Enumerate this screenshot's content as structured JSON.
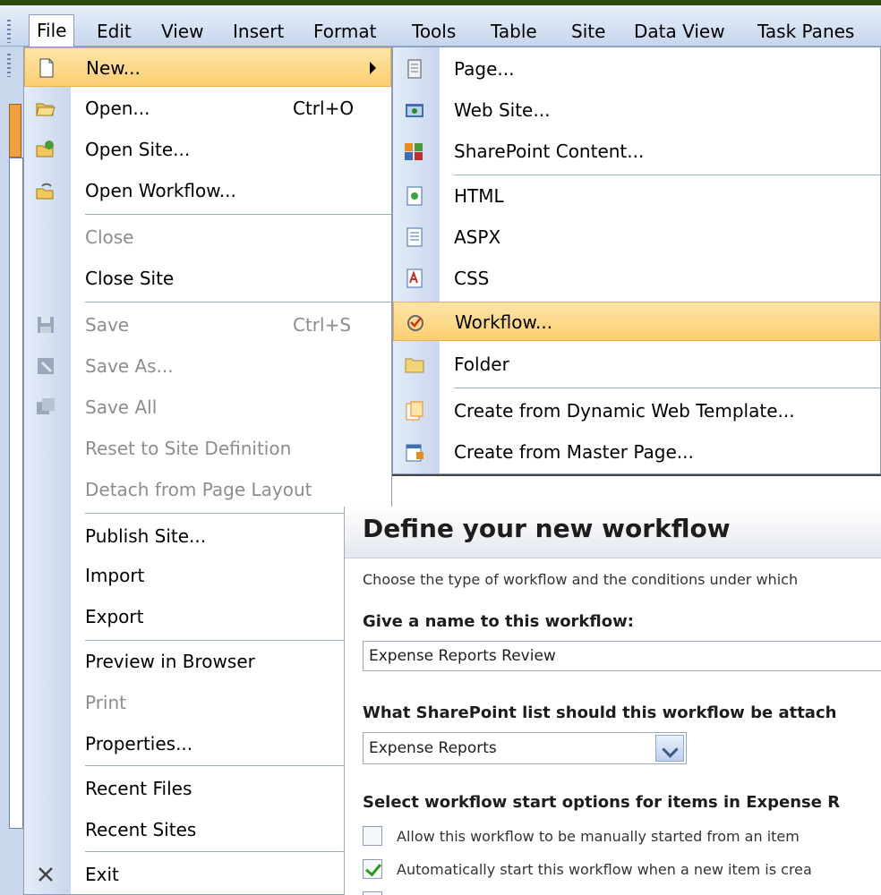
{
  "menubar": {
    "items": [
      {
        "label": "File",
        "active": true
      },
      {
        "label": "Edit"
      },
      {
        "label": "View"
      },
      {
        "label": "Insert"
      },
      {
        "label": "Format"
      },
      {
        "label": "Tools"
      },
      {
        "label": "Table"
      },
      {
        "label": "Site"
      },
      {
        "label": "Data View"
      },
      {
        "label": "Task Panes"
      }
    ]
  },
  "file_menu": {
    "items": [
      {
        "label": "New...",
        "icon": "new-page-icon",
        "highlighted": true,
        "submenu": true
      },
      {
        "label": "Open...",
        "shortcut": "Ctrl+O",
        "icon": "open-folder-icon"
      },
      {
        "label": "Open Site...",
        "icon": "open-site-icon"
      },
      {
        "label": "Open Workflow...",
        "icon": "open-workflow-icon"
      },
      {
        "label": "Close",
        "disabled": true
      },
      {
        "label": "Close Site"
      },
      {
        "label": "Save",
        "shortcut": "Ctrl+S",
        "disabled": true,
        "icon": "save-icon"
      },
      {
        "label": "Save As...",
        "disabled": true,
        "icon": "save-as-icon"
      },
      {
        "label": "Save All",
        "disabled": true,
        "icon": "save-all-icon"
      },
      {
        "label": "Reset to Site Definition",
        "disabled": true
      },
      {
        "label": "Detach from Page Layout",
        "disabled": true
      },
      {
        "label": "Publish Site..."
      },
      {
        "label": "Import"
      },
      {
        "label": "Export"
      },
      {
        "label": "Preview in Browser"
      },
      {
        "label": "Print",
        "disabled": true
      },
      {
        "label": "Properties..."
      },
      {
        "label": "Recent Files"
      },
      {
        "label": "Recent Sites"
      },
      {
        "label": "Exit",
        "icon": "close-x-icon"
      }
    ]
  },
  "new_submenu": {
    "items": [
      {
        "label": "Page...",
        "icon": "page-icon"
      },
      {
        "label": "Web Site...",
        "icon": "web-site-icon"
      },
      {
        "label": "SharePoint Content...",
        "icon": "sharepoint-content-icon"
      },
      {
        "label": "HTML",
        "icon": "html-icon"
      },
      {
        "label": "ASPX",
        "icon": "aspx-icon"
      },
      {
        "label": "CSS",
        "icon": "css-icon"
      },
      {
        "label": "Workflow...",
        "icon": "workflow-icon",
        "highlighted": true
      },
      {
        "label": "Folder",
        "icon": "folder-icon"
      },
      {
        "label": "Create from Dynamic Web Template...",
        "icon": "dynamic-template-icon"
      },
      {
        "label": "Create from Master Page...",
        "icon": "master-page-icon"
      }
    ]
  },
  "dialog": {
    "title": "Define your new workflow",
    "intro": "Choose the type of workflow and the conditions under which",
    "name_label": "Give a name to this workflow:",
    "name_value": "Expense Reports Review",
    "list_label": "What SharePoint list should this workflow be attach",
    "list_value": "Expense Reports",
    "start_label": "Select workflow start options for items in Expense R",
    "options": [
      {
        "label": "Allow this workflow to be manually started from an item",
        "checked": false
      },
      {
        "label": "Automatically start this workflow when a new item is crea",
        "checked": true
      }
    ]
  },
  "colors": {
    "highlight": "#fbcf70",
    "menu_border": "#8c9cba",
    "disabled_text": "#8d8d8d",
    "background": "#3b4a1f"
  }
}
